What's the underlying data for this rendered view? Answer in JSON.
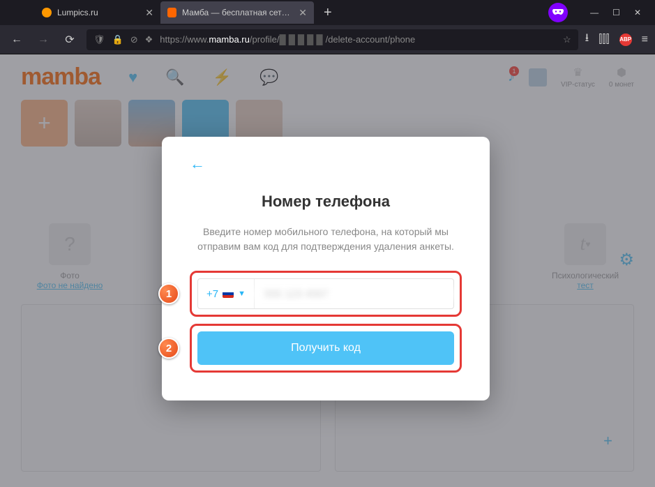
{
  "browser": {
    "tabs": [
      {
        "label": "Lumpics.ru",
        "favicon": "#ff9800",
        "active": false
      },
      {
        "label": "Мамба — бесплатная сеть зна",
        "favicon": "#ff6600",
        "active": true
      }
    ],
    "url_prefix": "https://www.",
    "url_domain": "mamba.ru",
    "url_path1": "/profile/",
    "url_path2": "/delete-account/phone",
    "minimize": "—",
    "maximize": "☐",
    "close": "✕"
  },
  "header": {
    "logo": "mamba",
    "vip": "VIP-статус",
    "coins": "0 монет",
    "badge": "1"
  },
  "tiles": {
    "photo_label": "Фото",
    "photo_link": "Фото не найдено",
    "test_label": "Психологический",
    "test_link": "тест"
  },
  "modal": {
    "title": "Номер телефона",
    "subtitle": "Введите номер мобильного телефона, на который мы отправим вам код для подтверждения удаления анкеты.",
    "country_code": "+7",
    "phone_placeholder": " ",
    "button": "Получить код"
  },
  "annotations": {
    "step1": "1",
    "step2": "2"
  }
}
